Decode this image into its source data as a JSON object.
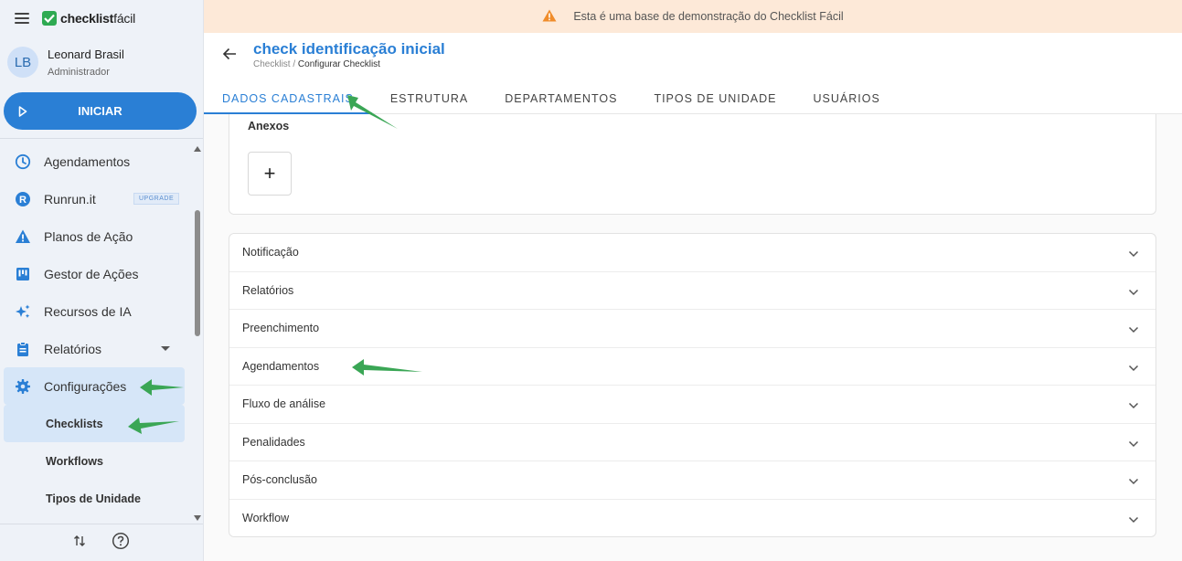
{
  "app": {
    "logo_bold": "checklist",
    "logo_light": "fácil"
  },
  "user": {
    "initials": "LB",
    "name": "Leonard Brasil",
    "role": "Administrador"
  },
  "start_button": {
    "label": "INICIAR"
  },
  "nav": {
    "items": [
      {
        "label": "Agendamentos",
        "icon": "clock-icon"
      },
      {
        "label": "Runrun.it",
        "icon": "runrun-icon",
        "badge": "UPGRADE"
      },
      {
        "label": "Planos de Ação",
        "icon": "warning-icon"
      },
      {
        "label": "Gestor de Ações",
        "icon": "kanban-icon"
      },
      {
        "label": "Recursos de IA",
        "icon": "sparkle-icon"
      },
      {
        "label": "Relatórios",
        "icon": "clipboard-icon"
      },
      {
        "label": "Configurações",
        "icon": "gear-icon"
      }
    ],
    "sub_items": [
      {
        "label": "Checklists"
      },
      {
        "label": "Workflows"
      },
      {
        "label": "Tipos de Unidade"
      }
    ]
  },
  "banner": {
    "text": "Esta é uma base de demonstração do Checklist Fácil"
  },
  "header": {
    "title": "check identificação inicial",
    "breadcrumb_root": "Checklist",
    "breadcrumb_sep": " / ",
    "breadcrumb_current": "Configurar Checklist"
  },
  "tabs": [
    {
      "label": "DADOS CADASTRAIS",
      "active": true
    },
    {
      "label": "ESTRUTURA"
    },
    {
      "label": "DEPARTAMENTOS"
    },
    {
      "label": "TIPOS DE UNIDADE"
    },
    {
      "label": "USUÁRIOS"
    }
  ],
  "attachments": {
    "title": "Anexos",
    "add_label": "+"
  },
  "sections": [
    "Notificação",
    "Relatórios",
    "Preenchimento",
    "Agendamentos",
    "Fluxo de análise",
    "Penalidades",
    "Pós-conclusão",
    "Workflow"
  ],
  "colors": {
    "accent": "#2a7fd5",
    "brand_green": "#2eaa52",
    "banner_bg": "#fde9d8",
    "sidebar_bg": "#eef2f8",
    "annotation_arrow": "#3aa655"
  }
}
